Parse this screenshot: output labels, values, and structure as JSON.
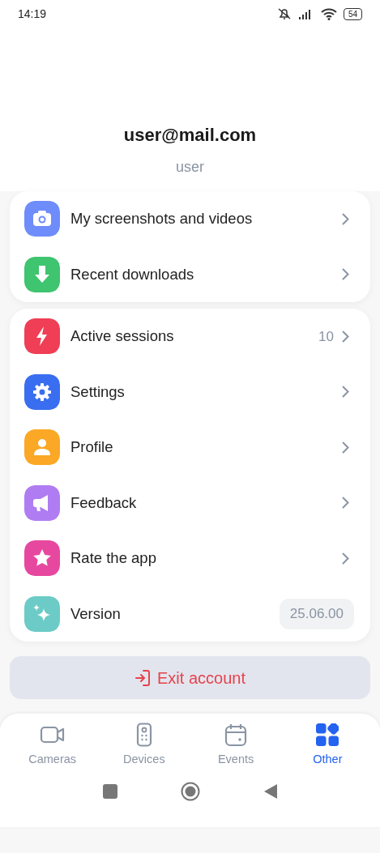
{
  "status_bar": {
    "time": "14:19",
    "battery": "54"
  },
  "account": {
    "email": "user@mail.com",
    "username": "user"
  },
  "groups": [
    {
      "items": [
        {
          "kind": "camera",
          "label": "My screenshots and videos",
          "color": "#6f8cfb",
          "chevron": true
        },
        {
          "kind": "download",
          "label": "Recent downloads",
          "color": "#3fc46f",
          "chevron": true
        }
      ]
    },
    {
      "items": [
        {
          "kind": "bolt",
          "label": "Active sessions",
          "color": "#f03e56",
          "count": "10",
          "chevron": true
        },
        {
          "kind": "gear",
          "label": "Settings",
          "color": "#3a6ef0",
          "chevron": true
        },
        {
          "kind": "person",
          "label": "Profile",
          "color": "#fba826",
          "chevron": true
        },
        {
          "kind": "megaphone",
          "label": "Feedback",
          "color": "#b07cf2",
          "chevron": true
        },
        {
          "kind": "star",
          "label": "Rate the app",
          "color": "#e7489f",
          "chevron": true
        },
        {
          "kind": "sparkle",
          "label": "Version",
          "color": "#6ccbc6",
          "badge": "25.06.00",
          "chevron": false
        }
      ]
    }
  ],
  "exit_button": {
    "label": "Exit account"
  },
  "tabs": [
    {
      "kind": "camera",
      "label": "Cameras",
      "selected": false
    },
    {
      "kind": "remote",
      "label": "Devices",
      "selected": false
    },
    {
      "kind": "calendar",
      "label": "Events",
      "selected": false
    },
    {
      "kind": "grid",
      "label": "Other",
      "selected": true
    }
  ]
}
